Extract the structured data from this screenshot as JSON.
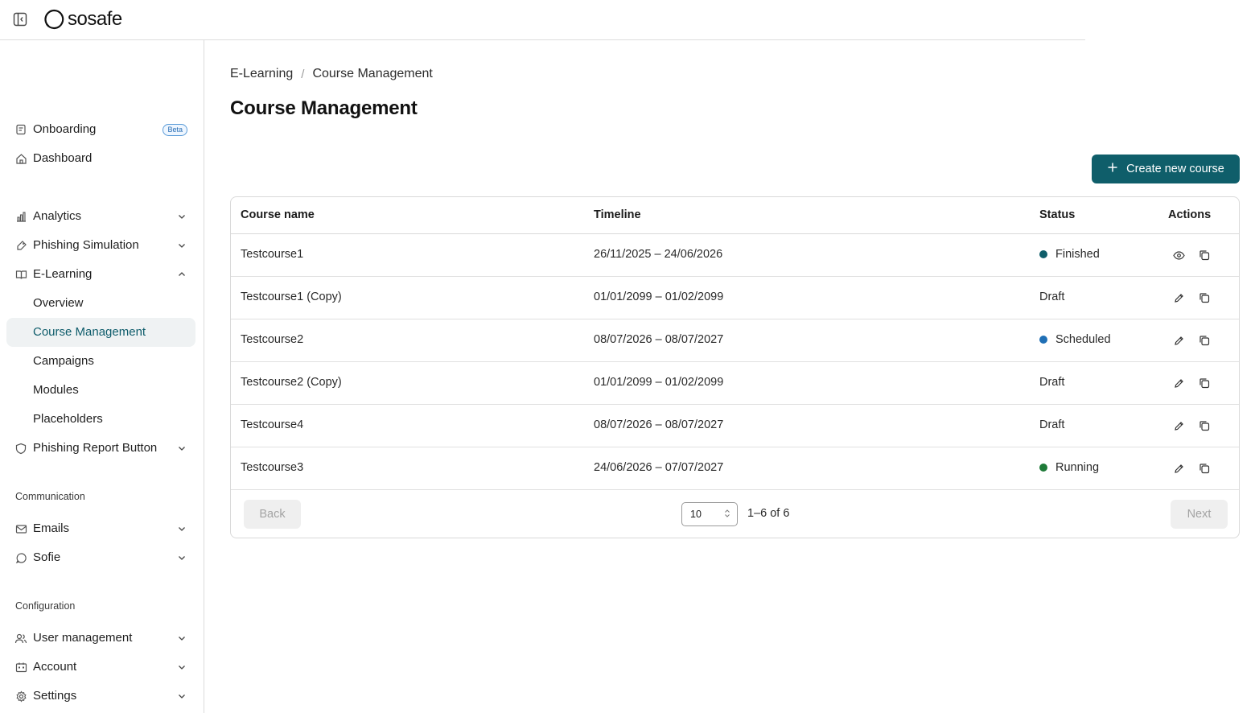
{
  "app": {
    "logo_text": "sosafe"
  },
  "sidebar": {
    "items": [
      {
        "label": "Onboarding",
        "badge": "Beta",
        "icon": "clipboard-icon"
      },
      {
        "label": "Dashboard",
        "icon": "home-icon"
      },
      {
        "label": "Analytics",
        "icon": "bar-chart-icon"
      },
      {
        "label": "Phishing Simulation",
        "icon": "hook-icon"
      },
      {
        "label": "E-Learning",
        "icon": "book-icon"
      },
      {
        "label": "Overview"
      },
      {
        "label": "Course Management"
      },
      {
        "label": "Campaigns"
      },
      {
        "label": "Modules"
      },
      {
        "label": "Placeholders"
      },
      {
        "label": "Phishing Report Button",
        "icon": "shield-icon"
      },
      {
        "label": "Emails",
        "icon": "mail-icon"
      },
      {
        "label": "Sofie",
        "icon": "chat-icon"
      },
      {
        "label": "User management",
        "icon": "users-icon"
      },
      {
        "label": "Account",
        "icon": "building-icon"
      },
      {
        "label": "Settings",
        "icon": "gear-icon"
      }
    ],
    "sections": {
      "communication": "Communication",
      "configuration": "Configuration"
    }
  },
  "breadcrumb": {
    "parent": "E-Learning",
    "separator": "/",
    "current": "Course Management"
  },
  "page": {
    "title": "Course Management",
    "create_button": "Create new course"
  },
  "table": {
    "headers": {
      "name": "Course name",
      "timeline": "Timeline",
      "status": "Status",
      "actions": "Actions"
    },
    "rows": [
      {
        "name": "Testcourse1",
        "timeline": "26/11/2025 – 24/06/2026",
        "status": "Finished",
        "status_color": "#0f5e6a",
        "primary_action": "view"
      },
      {
        "name": "Testcourse1 (Copy)",
        "timeline": "01/01/2099 – 01/02/2099",
        "status": "Draft",
        "status_color": "",
        "primary_action": "edit"
      },
      {
        "name": "Testcourse2",
        "timeline": "08/07/2026 – 08/07/2027",
        "status": "Scheduled",
        "status_color": "#1f6fb5",
        "primary_action": "edit"
      },
      {
        "name": "Testcourse2 (Copy)",
        "timeline": "01/01/2099 – 01/02/2099",
        "status": "Draft",
        "status_color": "",
        "primary_action": "edit"
      },
      {
        "name": "Testcourse4",
        "timeline": "08/07/2026 – 08/07/2027",
        "status": "Draft",
        "status_color": "",
        "primary_action": "edit"
      },
      {
        "name": "Testcourse3",
        "timeline": "24/06/2026 – 07/07/2027",
        "status": "Running",
        "status_color": "#1e7a38",
        "primary_action": "edit"
      }
    ]
  },
  "pagination": {
    "back": "Back",
    "next": "Next",
    "page_size": "10",
    "range": "1–6 of 6"
  },
  "colors": {
    "accent": "#0f5e6a",
    "active_bg": "#eff2f3",
    "border": "#d9d9d9"
  }
}
